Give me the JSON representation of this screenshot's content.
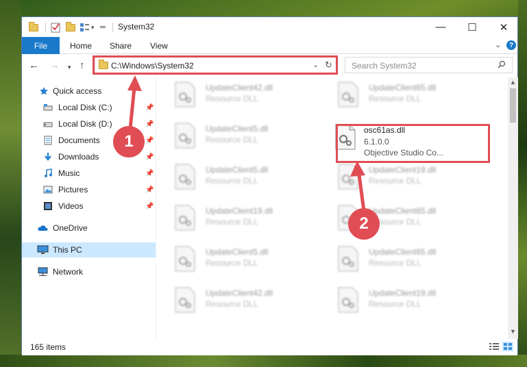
{
  "window": {
    "title": "System32",
    "controls": {
      "minimize": "—",
      "maximize": "☐",
      "close": "✕"
    }
  },
  "ribbon": {
    "tabs": [
      "File",
      "Home",
      "Share",
      "View"
    ],
    "help": "?"
  },
  "navbar": {
    "address": "C:\\Windows\\System32",
    "search_placeholder": "Search System32"
  },
  "nav_pane": {
    "quick_access": "Quick access",
    "items": [
      {
        "label": "Local Disk (C:)",
        "icon": "drive-icon",
        "pinned": true
      },
      {
        "label": "Local Disk (D:)",
        "icon": "drive-icon",
        "pinned": true
      },
      {
        "label": "Documents",
        "icon": "documents-icon",
        "pinned": true
      },
      {
        "label": "Downloads",
        "icon": "download-icon",
        "pinned": true
      },
      {
        "label": "Music",
        "icon": "music-icon",
        "pinned": true
      },
      {
        "label": "Pictures",
        "icon": "pictures-icon",
        "pinned": true
      },
      {
        "label": "Videos",
        "icon": "videos-icon",
        "pinned": true
      }
    ],
    "onedrive": "OneDrive",
    "this_pc": "This PC",
    "network": "Network"
  },
  "files": {
    "left": [
      {
        "name": "UpdateClient42.dll",
        "desc": "Resource DLL"
      },
      {
        "name": "UpdateClient5.dll",
        "desc": "Resource DLL"
      },
      {
        "name": "UpdateClient5.dll",
        "desc": "Resource DLL"
      },
      {
        "name": "UpdateClient19.dll",
        "desc": "Resource DLL"
      },
      {
        "name": "UpdateClient5.dll",
        "desc": "Resource DLL"
      },
      {
        "name": "UpdateClient42.dll",
        "desc": "Resource DLL"
      }
    ],
    "right": [
      {
        "name": "UpdateClient65.dll",
        "desc": "Resource DLL"
      },
      {
        "name": "osc61as.dll",
        "version": "6.1.0.0",
        "company": "Objective Studio Co..."
      },
      {
        "name": "UpdateClient19.dll",
        "desc": "Resource DLL"
      },
      {
        "name": "UpdateClient65.dll",
        "desc": "Resource DLL"
      },
      {
        "name": "UpdateClient65.dll",
        "desc": "Resource DLL"
      },
      {
        "name": "UpdateClient19.dll",
        "desc": "Resource DLL"
      }
    ]
  },
  "status": {
    "items": "165 items"
  },
  "annotations": {
    "step1": "1",
    "step2": "2",
    "accent": "#e14d54"
  }
}
